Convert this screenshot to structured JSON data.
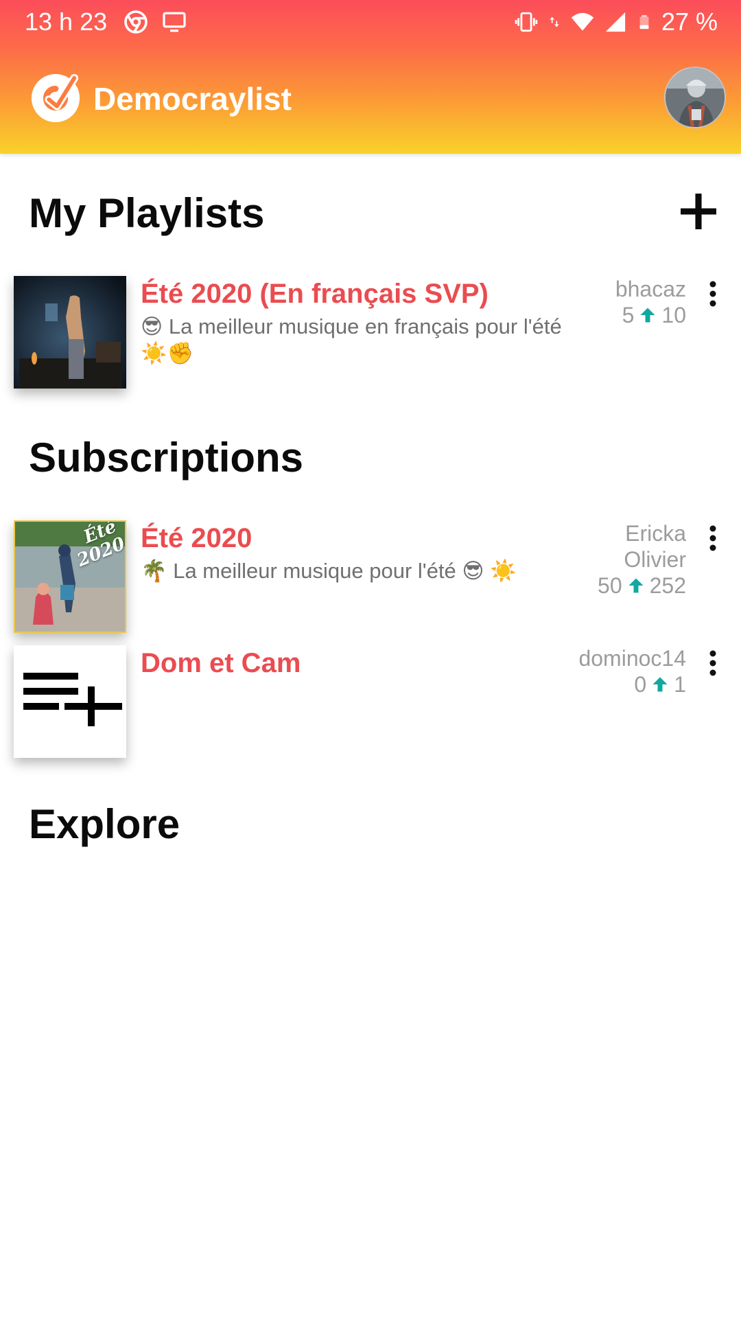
{
  "status_bar": {
    "time": "13 h 23",
    "battery": "27 %",
    "left_icons": [
      "chrome-icon",
      "cast-screen-icon"
    ],
    "right_icons": [
      "vibrate-icon",
      "data-transfer-icon",
      "wifi-icon",
      "signal-icon",
      "battery-icon"
    ]
  },
  "app_bar": {
    "title": "Democraylist",
    "logo_icon": "democraylist-logo-icon",
    "avatar": "user-avatar"
  },
  "colors": {
    "header_gradient_top": "#fc4d5a",
    "header_gradient_bottom": "#f9d22b",
    "playlist_title": "#ea4c50",
    "upvote_arrow": "#11a8a0",
    "meta_text": "#9c9c9c"
  },
  "sections": {
    "my_playlists": {
      "title": "My Playlists",
      "add_icon": "plus-icon",
      "items": [
        {
          "title": "Été 2020 (En français SVP)",
          "description": "😎 La meilleur musique en français pour l'été ☀️✊",
          "owner": "bhacaz",
          "upvotes": "5",
          "subscribers": "10"
        }
      ]
    },
    "subscriptions": {
      "title": "Subscriptions",
      "items": [
        {
          "title": "Été 2020",
          "description": "🌴 La meilleur musique pour l'été 😎 ☀️",
          "owner": "Ericka Olivier",
          "upvotes": "50",
          "subscribers": "252",
          "cover_text": "Été 2020"
        },
        {
          "title": "Dom et Cam",
          "description": "",
          "owner": "dominoc14",
          "upvotes": "0",
          "subscribers": "1",
          "cover_icon": "playlist-add-icon"
        }
      ]
    },
    "explore": {
      "title": "Explore"
    }
  }
}
